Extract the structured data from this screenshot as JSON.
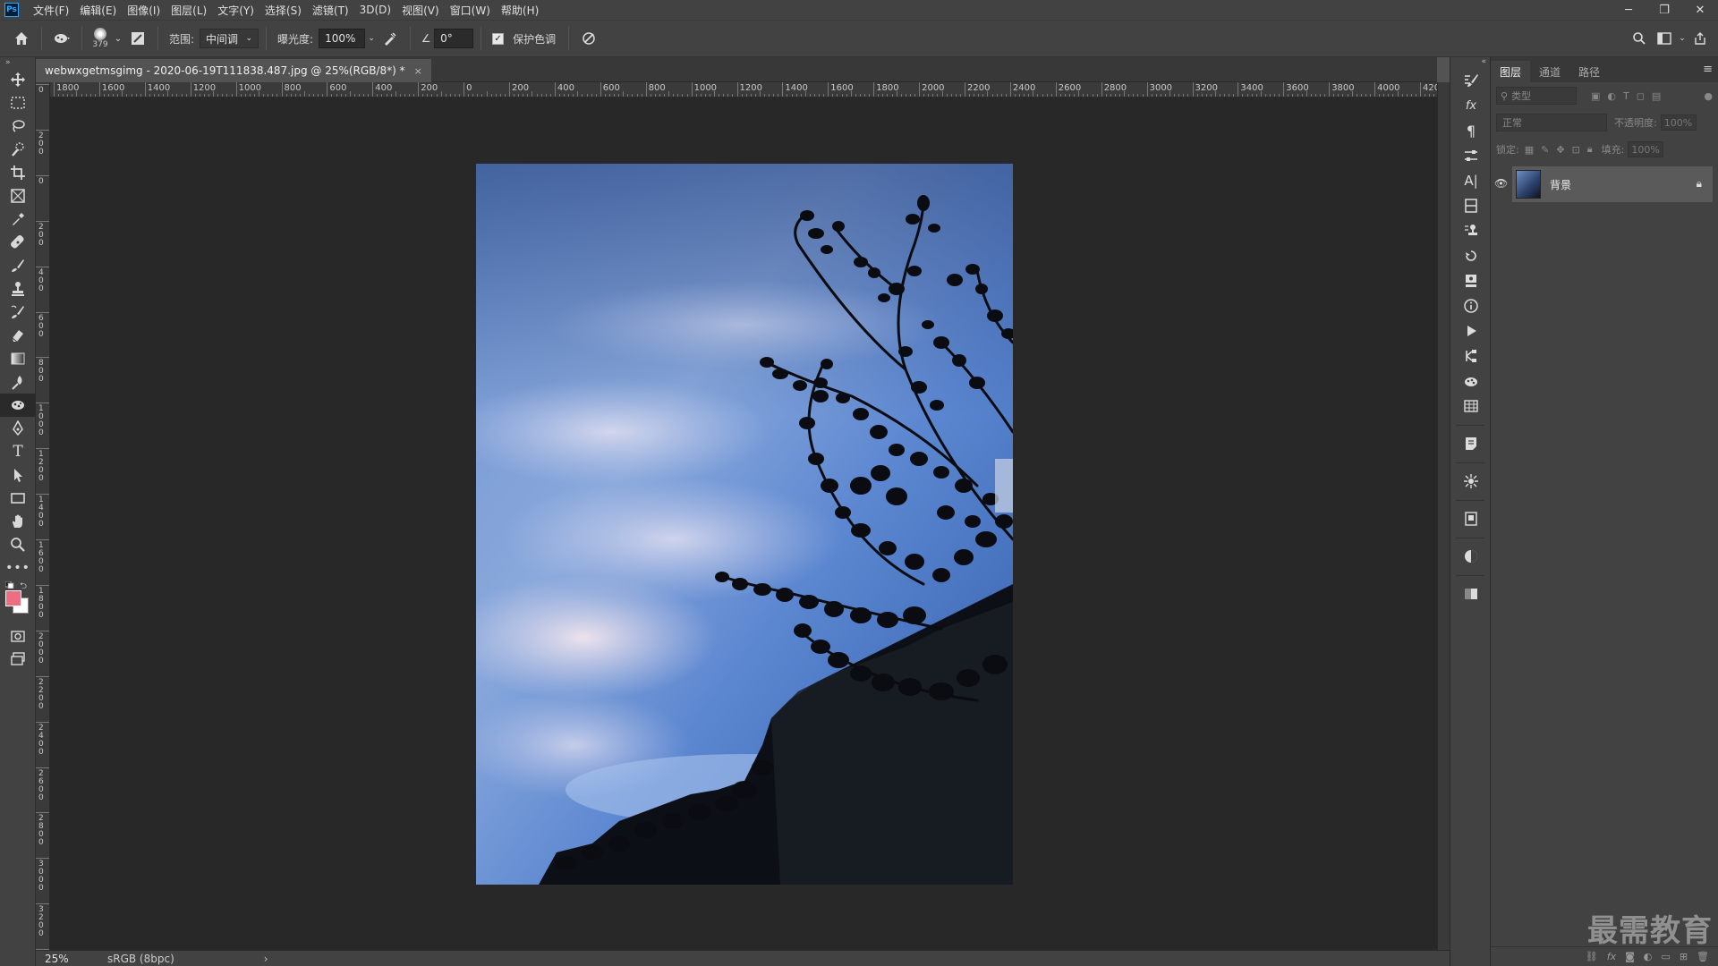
{
  "app": {
    "logo": "Ps"
  },
  "menu": [
    "文件(F)",
    "编辑(E)",
    "图像(I)",
    "图层(L)",
    "文字(Y)",
    "选择(S)",
    "滤镜(T)",
    "3D(D)",
    "视图(V)",
    "窗口(W)",
    "帮助(H)"
  ],
  "window_controls": {
    "minimize": "─",
    "restore": "❐",
    "close": "✕"
  },
  "options": {
    "brush_size": "379",
    "range_label": "范围:",
    "range_value": "中间调",
    "exposure_label": "曝光度:",
    "exposure_value": "100%",
    "angle_value": "0°",
    "protect_tones_label": "保护色调",
    "protect_tones_checked": true
  },
  "document": {
    "tab_title": "webwxgetmsgimg - 2020-06-19T111838.487.jpg @ 25%(RGB/8*) *",
    "close": "×"
  },
  "ruler": {
    "h_labels": [
      "1800",
      "1600",
      "1400",
      "1200",
      "1000",
      "800",
      "600",
      "400",
      "200",
      "0",
      "200",
      "400",
      "600",
      "800",
      "1000",
      "1200",
      "1400",
      "1600",
      "1800",
      "2000",
      "2200",
      "2400",
      "2600",
      "2800",
      "3000",
      "3200",
      "3400",
      "3600",
      "3800",
      "4000",
      "420"
    ],
    "v_labels": [
      "0",
      "200",
      "0",
      "200",
      "400",
      "600",
      "800",
      "1000",
      "1200",
      "1400",
      "1600",
      "1800",
      "2000",
      "2200",
      "2400",
      "2600",
      "2800",
      "3000",
      "3200",
      "3400"
    ]
  },
  "status": {
    "zoom": "25%",
    "color_profile": "sRGB (8bpc)",
    "arrow": "›"
  },
  "panels": {
    "tabs": [
      "图层",
      "通道",
      "路径"
    ],
    "filter_placeholder": "类型",
    "blend_mode": "正常",
    "opacity_label": "不透明度:",
    "opacity_value": "100%",
    "lock_label": "锁定:",
    "fill_label": "填充:",
    "fill_value": "100%",
    "layer_name": "背景"
  },
  "watermark": "最需教育",
  "colors": {
    "foreground": "#ef6d82",
    "background": "#ffffff",
    "accent": "#31a8ff"
  }
}
